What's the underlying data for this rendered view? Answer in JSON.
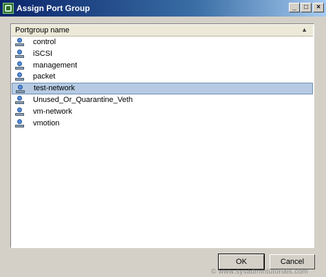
{
  "window": {
    "title": "Assign Port Group",
    "min_glyph": "_",
    "max_glyph": "□",
    "close_glyph": "×"
  },
  "list": {
    "column_header": "Portgroup name",
    "sort_glyph": "▲",
    "items": [
      {
        "label": "control",
        "icon": "portgroup-icon",
        "selected": false
      },
      {
        "label": "iSCSI",
        "icon": "portgroup-icon",
        "selected": false
      },
      {
        "label": "management",
        "icon": "portgroup-icon",
        "selected": false
      },
      {
        "label": "packet",
        "icon": "portgroup-icon",
        "selected": false
      },
      {
        "label": "test-network",
        "icon": "portgroup-icon",
        "selected": true
      },
      {
        "label": "Unused_Or_Quarantine_Veth",
        "icon": "portgroup-icon",
        "selected": false
      },
      {
        "label": "vm-network",
        "icon": "portgroup-icon",
        "selected": false
      },
      {
        "label": "vmotion",
        "icon": "portgroup-icon",
        "selected": false
      }
    ]
  },
  "buttons": {
    "ok_label": "OK",
    "cancel_label": "Cancel"
  },
  "watermark": "© www.sysadmintutorials.com",
  "colors": {
    "title_gradient_start": "#0a246a",
    "selection_bg": "#b6cbe3",
    "window_bg": "#d4d0c8"
  }
}
